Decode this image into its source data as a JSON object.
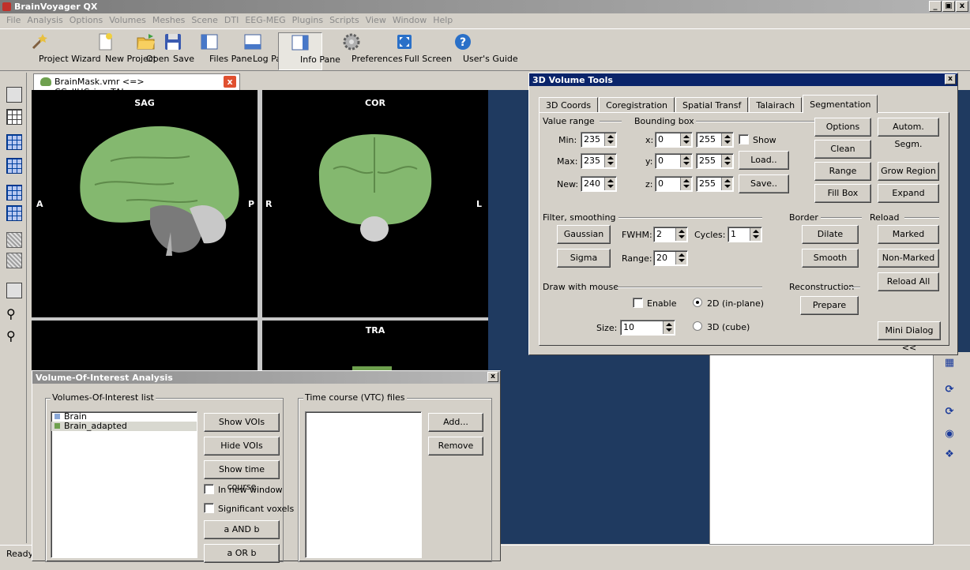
{
  "app": {
    "title": "BrainVoyager QX"
  },
  "window_controls": {
    "minimize": "_",
    "restore": "ÿ",
    "close": "x"
  },
  "menu": [
    "File",
    "Analysis",
    "Options",
    "Volumes",
    "Meshes",
    "Scene",
    "DTI",
    "EEG-MEG",
    "Plugins",
    "Scripts",
    "View",
    "Window",
    "Help"
  ],
  "toolbar": [
    {
      "label": "Project Wizard",
      "icon": "wand-icon"
    },
    {
      "label": "New Project",
      "icon": "new-file-icon"
    },
    {
      "label": "Open",
      "icon": "folder-icon"
    },
    {
      "label": "Save",
      "icon": "floppy-icon"
    },
    {
      "label": "Files Pane",
      "icon": "files-pane-icon"
    },
    {
      "label": "Log Pane",
      "icon": "log-pane-icon"
    },
    {
      "label": "Info Pane",
      "icon": "info-pane-icon"
    },
    {
      "label": "Preferences",
      "icon": "gear-icon"
    },
    {
      "label": "Full Screen",
      "icon": "fullscreen-icon"
    },
    {
      "label": "User's Guide",
      "icon": "help-icon"
    }
  ],
  "document": {
    "tab_label": "BrainMask.vmr  <=>  CG_IIHC_ic_aTAL.vmr",
    "close_glyph": "x"
  },
  "views": {
    "sag": {
      "label": "SAG",
      "left": "A",
      "right": "P"
    },
    "cor": {
      "label": "COR",
      "left": "R",
      "right": "L"
    },
    "tra": {
      "label": "TRA"
    }
  },
  "status": {
    "text": "Ready"
  },
  "volume_tools": {
    "title": "3D Volume Tools",
    "close_glyph": "x",
    "tabs": [
      "3D Coords",
      "Coregistration",
      "Spatial Transf",
      "Talairach",
      "Segmentation"
    ],
    "active_tab": "Segmentation",
    "value_range": {
      "title": "Value range",
      "min_label": "Min:",
      "min": "235",
      "max_label": "Max:",
      "max": "235",
      "new_label": "New:",
      "new": "240"
    },
    "bounding_box": {
      "title": "Bounding box",
      "x_label": "x:",
      "x_from": "0",
      "x_to": "255",
      "y_label": "y:",
      "y_from": "0",
      "y_to": "255",
      "z_label": "z:",
      "z_from": "0",
      "z_to": "255",
      "show_label": "Show",
      "load": "Load..",
      "save": "Save.."
    },
    "buttons": {
      "options": "Options",
      "auto_segm": "Autom. Segm.",
      "clean": "Clean",
      "range": "Range",
      "grow_region": "Grow Region",
      "fill_box": "Fill Box",
      "expand": "Expand"
    },
    "filter": {
      "title": "Filter, smoothing",
      "gaussian": "Gaussian",
      "sigma": "Sigma",
      "fwhm_label": "FWHM:",
      "fwhm": "2",
      "cycles_label": "Cycles:",
      "cycles": "1",
      "range_label": "Range:",
      "range": "20"
    },
    "border": {
      "title": "Border",
      "dilate": "Dilate",
      "smooth": "Smooth"
    },
    "reload": {
      "title": "Reload",
      "marked": "Marked",
      "non_marked": "Non-Marked",
      "reload_all": "Reload All"
    },
    "draw": {
      "title": "Draw with mouse",
      "enable": "Enable",
      "mode_2d": "2D (in-plane)",
      "mode_3d": "3D (cube)",
      "size_label": "Size:",
      "size": "10"
    },
    "reconstruction": {
      "title": "Reconstruction",
      "prepare": "Prepare"
    },
    "mini_dialog": "Mini Dialog <<"
  },
  "voi": {
    "title": "Volume-Of-Interest Analysis",
    "close_glyph": "x",
    "list_title": "Volumes-Of-Interest list",
    "items": [
      {
        "name": "Brain",
        "color": "#8aa8d8"
      },
      {
        "name": "Brain_adapted",
        "color": "#6ea04e"
      }
    ],
    "show_vois": "Show VOIs",
    "hide_vois": "Hide VOIs",
    "show_time_course": "Show time course",
    "in_new_window": "In new window",
    "significant_voxels": "Significant voxels",
    "a_and_b": "a AND b",
    "a_or_b": "a OR b",
    "vtc_title": "Time course (VTC) files",
    "add": "Add...",
    "remove": "Remove"
  },
  "colors": {
    "titlebar_active": "#0a246a",
    "workspace": "#1f3a60",
    "mask_green": "#8fc878"
  }
}
